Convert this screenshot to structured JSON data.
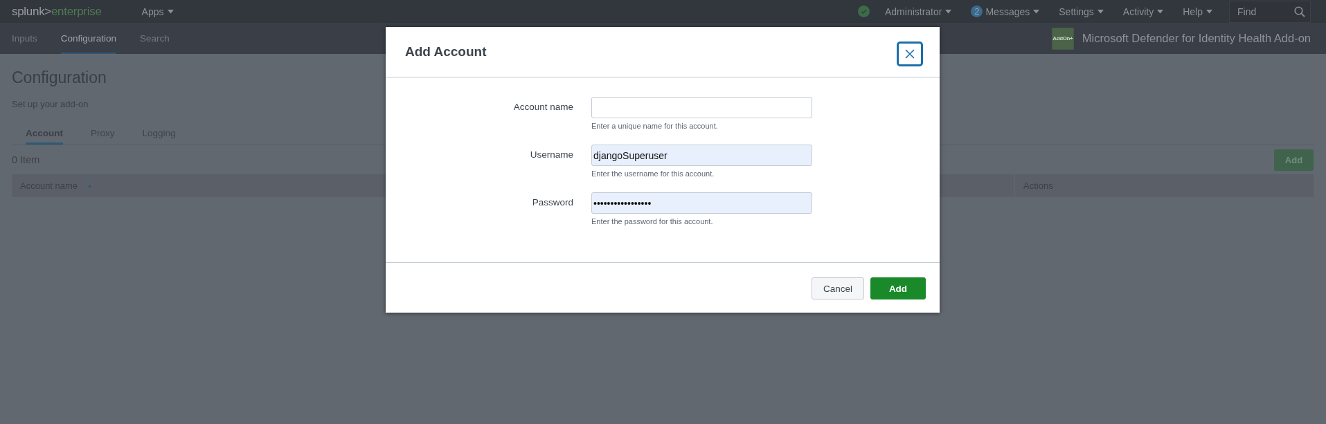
{
  "top_bar": {
    "logo_primary": "splunk>",
    "logo_secondary": "enterprise",
    "apps_menu": "Apps",
    "user_menu": "Administrator",
    "messages_count": "2",
    "messages_menu": "Messages",
    "menus": [
      "Settings",
      "Activity",
      "Help"
    ],
    "search": {
      "placeholder": "Find"
    }
  },
  "app_bar": {
    "tabs": [
      {
        "label": "Inputs",
        "selected": false
      },
      {
        "label": "Configuration",
        "selected": true
      },
      {
        "label": "Search",
        "selected": false
      }
    ],
    "app_logo_text": "AddOn+",
    "app_title": "Microsoft Defender for Identity Health Add-on"
  },
  "page": {
    "title": "Configuration",
    "subtitle": "Set up your add-on",
    "tabs": [
      {
        "label": "Account",
        "selected": true
      },
      {
        "label": "Proxy",
        "selected": false
      },
      {
        "label": "Logging",
        "selected": false
      }
    ],
    "item_count": "0 Item",
    "add_button": "Add",
    "table": {
      "columns": [
        {
          "label": "Account name",
          "sorted": true
        },
        {
          "label": "Actions",
          "sorted": false
        }
      ]
    }
  },
  "dialog": {
    "title": "Add Account",
    "fields": [
      {
        "label": "Account name",
        "help": "Enter a unique name for this account.",
        "autofilled": false
      },
      {
        "label": "Username",
        "value": "djangoSuperuser",
        "help": "Enter the username for this account.",
        "autofilled": true
      },
      {
        "label": "Password",
        "value": "•••••••••••••••••",
        "help": "Enter the password for this account.",
        "autofilled": true
      }
    ],
    "buttons": [
      {
        "label": "Cancel",
        "kind": "secondary"
      },
      {
        "label": "Add",
        "kind": "primary"
      }
    ]
  }
}
